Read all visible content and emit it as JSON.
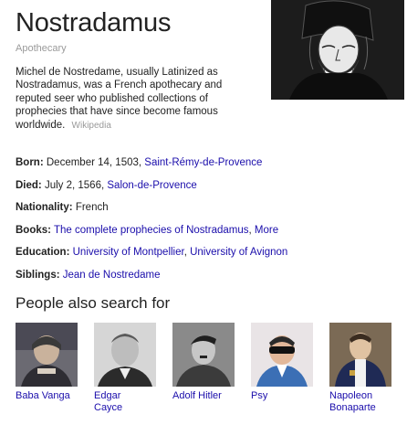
{
  "header": {
    "title": "Nostradamus",
    "subtitle": "Apothecary",
    "image_icon": "portrait-illustration-icon"
  },
  "description": {
    "text": "Michel de Nostredame, usually Latinized as Nostradamus, was a French apothecary and reputed seer who published collections of prophecies that have since become famous worldwide.",
    "source": "Wikipedia"
  },
  "facts": {
    "born": {
      "label": "Born:",
      "text": "December 14, 1503,",
      "link": "Saint-Rémy-de-Provence"
    },
    "died": {
      "label": "Died:",
      "text": "July 2, 1566,",
      "link": "Salon-de-Provence"
    },
    "nationality": {
      "label": "Nationality:",
      "text": "French"
    },
    "books": {
      "label": "Books:",
      "link1": "The complete prophecies of Nostradamus",
      "sep": ",",
      "link2": "More"
    },
    "education": {
      "label": "Education:",
      "link1": "University of Montpellier",
      "sep": ",",
      "link2": "University of Avignon"
    },
    "siblings": {
      "label": "Siblings:",
      "link": "Jean de Nostredame"
    }
  },
  "people_also_search": {
    "title": "People also search for",
    "people": [
      {
        "name": "Baba Vanga",
        "icon": "person-photo-icon"
      },
      {
        "name": "Edgar\nCayce",
        "icon": "person-photo-icon"
      },
      {
        "name": "Adolf Hitler",
        "icon": "person-photo-icon"
      },
      {
        "name": "Psy",
        "icon": "person-photo-icon"
      },
      {
        "name": "Napoleon\nBonaparte",
        "icon": "person-photo-icon"
      }
    ]
  },
  "colors": {
    "link": "#1a0dab",
    "muted": "#9a9a9a",
    "text": "#222222"
  }
}
